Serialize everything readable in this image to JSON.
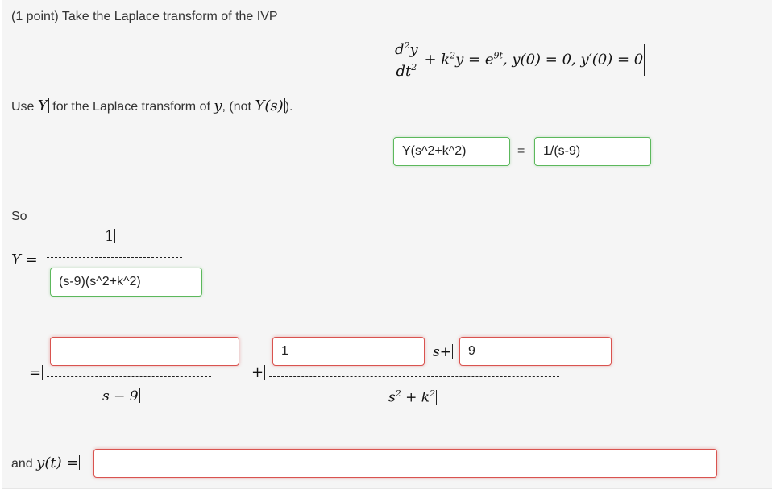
{
  "question": {
    "prefix": "(1 point)",
    "text": "Take the Laplace transform of the IVP"
  },
  "equation": {
    "num": "d",
    "num_sup": "2",
    "num_var": "y",
    "den": "dt",
    "den_sup": "2",
    "rest_1": "+ k",
    "rest_1_sup": "2",
    "rest_2": "y = e",
    "rest_2_sup": "9t",
    "rest_3": ", y(0) = 0, y′(0) = 0"
  },
  "instruction": {
    "part_1": "Use",
    "var_Y": "Y",
    "part_2": "for the Laplace transform of",
    "var_y": "y",
    "part_3": ", (not",
    "var_Ys": "Y(s)",
    "part_4": ")."
  },
  "transform_row": {
    "left_value": "Y(s^2+k^2)",
    "equals": "=",
    "right_value": "1/(s-9)"
  },
  "so_label": "So",
  "Y_fraction": {
    "label": "Y =",
    "numerator": "1",
    "denominator_value": "(s-9)(s^2+k^2)"
  },
  "partial_fractions": {
    "equals": "=",
    "first_numerator_value": "",
    "first_denominator": "s − 9",
    "plus": "+",
    "second_numerator_value_a": "1",
    "s_label": "s+",
    "second_numerator_value_b": "9",
    "second_denominator": "s",
    "second_denominator_sup": "2",
    "second_denominator_tail": "+ k",
    "second_denominator_tail_sup": "2"
  },
  "final": {
    "label_text": "and",
    "label_math": "y(t) =",
    "value": ""
  },
  "colors": {
    "correct_border": "#5cb85c",
    "incorrect_border": "#d9534f",
    "panel_background": "#f5f5f5"
  }
}
